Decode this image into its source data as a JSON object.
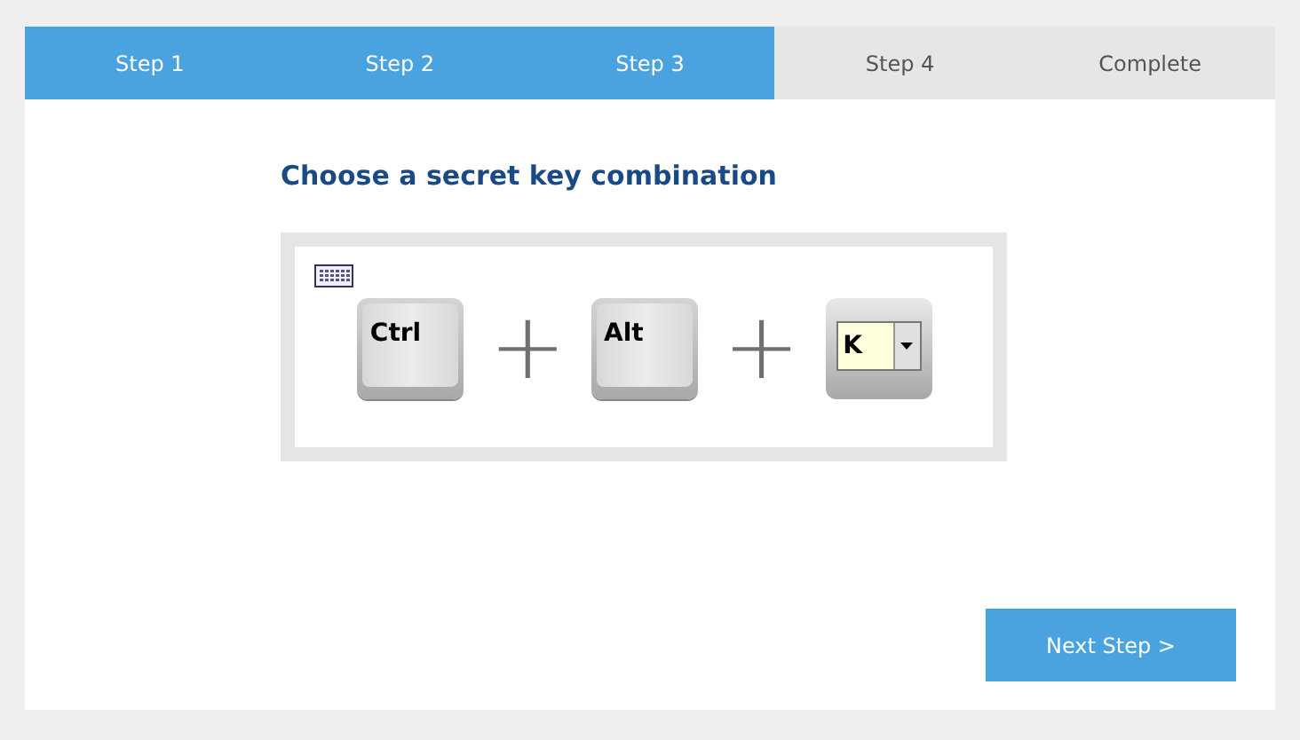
{
  "steps": [
    {
      "label": "Step 1",
      "reached": true
    },
    {
      "label": "Step 2",
      "reached": true
    },
    {
      "label": "Step 3",
      "reached": true
    },
    {
      "label": "Step 4",
      "reached": false
    },
    {
      "label": "Complete",
      "reached": false
    }
  ],
  "heading": "Choose a secret key combination",
  "keys": [
    {
      "kind": "fixed",
      "label": "Ctrl"
    },
    {
      "kind": "plus",
      "label": "+"
    },
    {
      "kind": "fixed",
      "label": "Alt"
    },
    {
      "kind": "plus",
      "label": "+"
    },
    {
      "kind": "select",
      "value": "K"
    }
  ],
  "next_button": "Next Step >"
}
